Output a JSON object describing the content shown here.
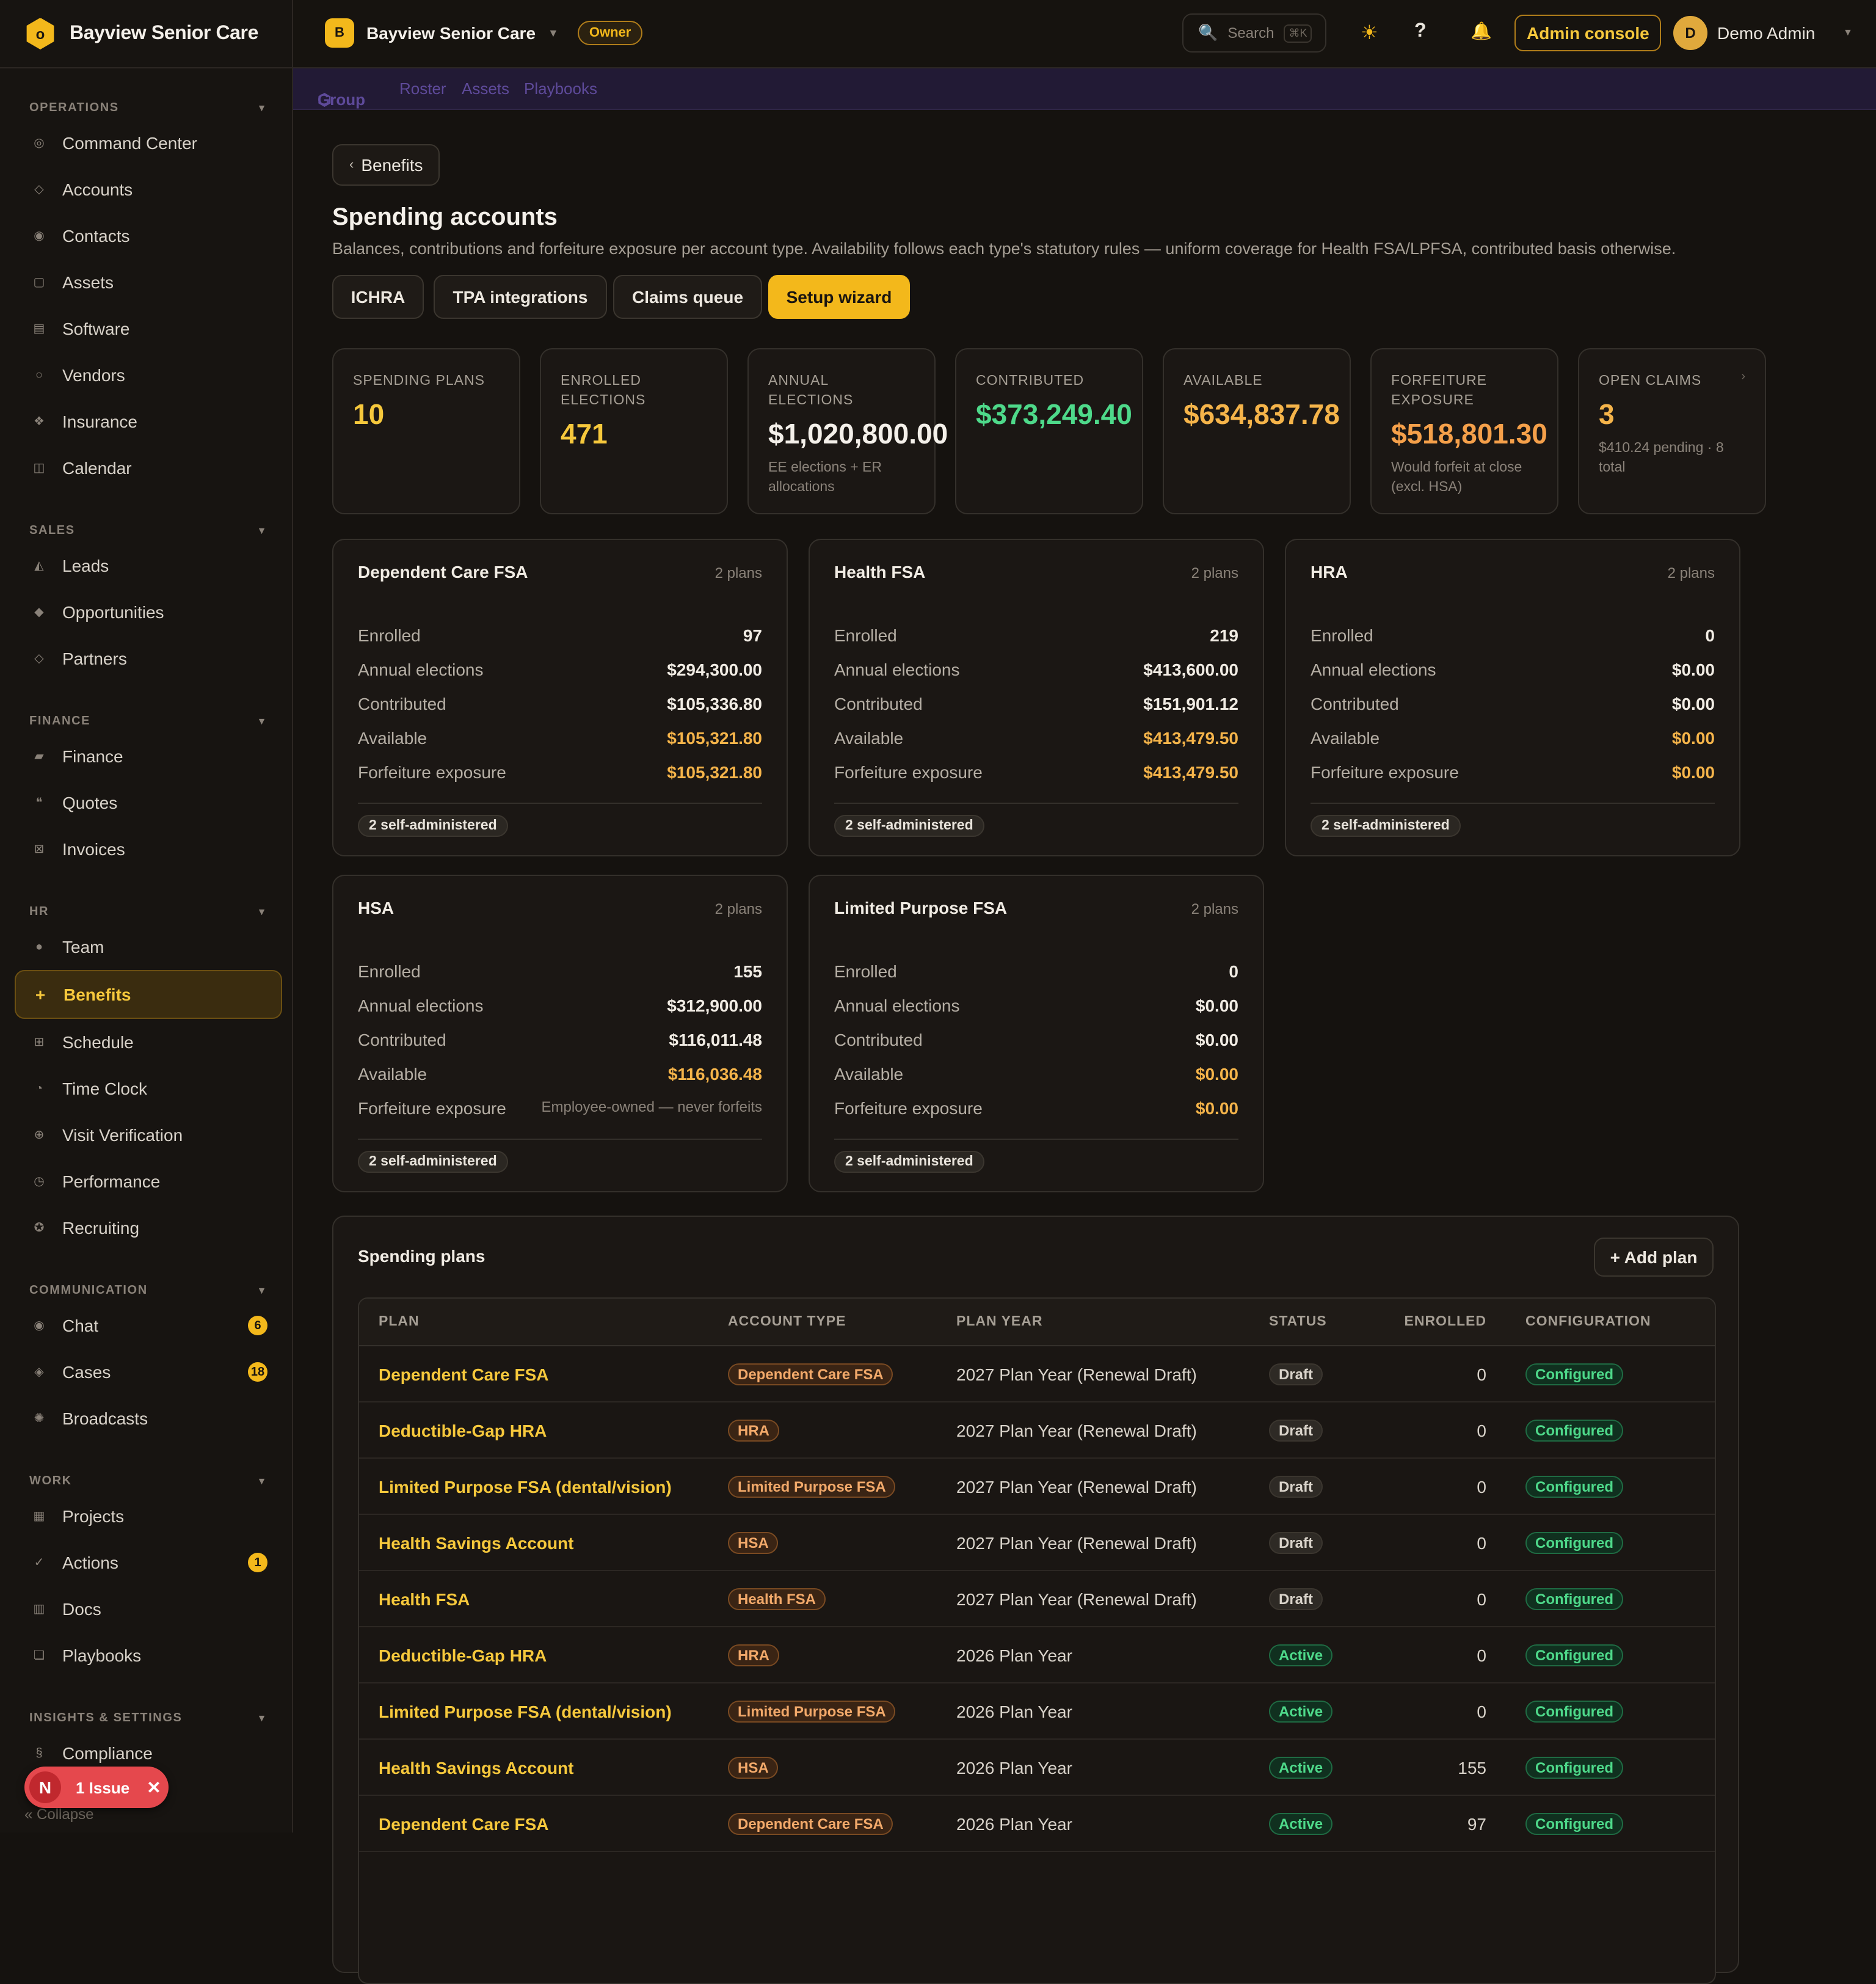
{
  "app": {
    "brand": "Bayview Senior Care",
    "logo_glyph": "o"
  },
  "topbar": {
    "org_initial": "B",
    "org_name": "Bayview Senior Care",
    "role_badge": "Owner",
    "search_placeholder": "Search",
    "search_shortcut": "⌘K",
    "admin_console": "Admin console",
    "user_initial": "D",
    "user_name": "Demo Admin"
  },
  "subnav": {
    "items": [
      "Group",
      "Roster",
      "Assets",
      "Playbooks"
    ],
    "current_marker": "⬡"
  },
  "sidebar": {
    "sections": [
      {
        "title": "OPERATIONS",
        "items": [
          "Command Center",
          "Accounts",
          "Contacts",
          "Assets",
          "Software",
          "Vendors",
          "Insurance",
          "Calendar"
        ]
      },
      {
        "title": "SALES",
        "items": [
          "Leads",
          "Opportunities",
          "Partners"
        ]
      },
      {
        "title": "FINANCE",
        "items": [
          "Finance",
          "Quotes",
          "Invoices"
        ]
      },
      {
        "title": "HR",
        "items": [
          "Team",
          "Benefits",
          "Schedule",
          "Time Clock",
          "Visit Verification",
          "Performance",
          "Recruiting"
        ]
      },
      {
        "title": "COMMUNICATION",
        "items": [
          "Chat",
          "Cases",
          "Broadcasts"
        ]
      },
      {
        "title": "WORK",
        "items": [
          "Projects",
          "Actions",
          "Docs",
          "Playbooks"
        ]
      },
      {
        "title": "INSIGHTS & SETTINGS",
        "items": [
          "Compliance"
        ]
      }
    ],
    "badges": {
      "chat": "6",
      "cases": "18",
      "actions": "1"
    },
    "active": "Benefits",
    "collapse_label": "Collapse",
    "issue_label": "1 Issue",
    "issue_avatar": "N"
  },
  "page": {
    "back_label": "Benefits",
    "title": "Spending accounts",
    "subtitle": "Balances, contributions and forfeiture exposure per account type. Availability follows each type's statutory rules — uniform coverage for Health FSA/LPFSA, contributed basis otherwise.",
    "buttons": [
      "ICHRA",
      "TPA integrations",
      "Claims queue",
      "Setup wizard"
    ]
  },
  "stats": [
    {
      "label": "Spending plans",
      "value": "10",
      "sub": "",
      "color": "#f6c83c"
    },
    {
      "label": "Enrolled elections",
      "value": "471",
      "sub": "",
      "color": "#f6c83c"
    },
    {
      "label": "Annual elections",
      "value": "$1,020,800.00",
      "sub": "EE elections + ER allocations",
      "color": "#f4f0ea"
    },
    {
      "label": "Contributed",
      "value": "$373,249.40",
      "sub": "",
      "color": "#4ed98a"
    },
    {
      "label": "Available",
      "value": "$634,837.78",
      "sub": "",
      "color": "#f5b44a"
    },
    {
      "label": "Forfeiture exposure",
      "value": "$518,801.30",
      "sub": "Would forfeit at close (excl. HSA)",
      "color": "#f5a04a"
    },
    {
      "label": "Open claims",
      "value": "3",
      "sub": "$410.24 pending · 8 total",
      "color": "#f5b44a"
    }
  ],
  "row_labels": [
    "Enrolled",
    "Annual elections",
    "Contributed",
    "Available",
    "Forfeiture exposure"
  ],
  "account_cards": [
    {
      "name": "Dependent Care FSA",
      "plans": "2 plans",
      "enrolled": "97",
      "elections": "$294,300.00",
      "contributed": "$105,336.80",
      "available": "$105,321.80",
      "forfeiture": "$105,321.80",
      "chip": "2 self-administered"
    },
    {
      "name": "Health FSA",
      "plans": "2 plans",
      "enrolled": "219",
      "elections": "$413,600.00",
      "contributed": "$151,901.12",
      "available": "$413,479.50",
      "forfeiture": "$413,479.50",
      "chip": "2 self-administered"
    },
    {
      "name": "HRA",
      "plans": "2 plans",
      "enrolled": "0",
      "elections": "$0.00",
      "contributed": "$0.00",
      "available": "$0.00",
      "forfeiture": "$0.00",
      "chip": "2 self-administered"
    },
    {
      "name": "HSA",
      "plans": "2 plans",
      "enrolled": "155",
      "elections": "$312,900.00",
      "contributed": "$116,011.48",
      "available": "$116,036.48",
      "forfeiture": "Employee-owned — never forfeits",
      "chip": "2 self-administered"
    },
    {
      "name": "Limited Purpose FSA",
      "plans": "2 plans",
      "enrolled": "0",
      "elections": "$0.00",
      "contributed": "$0.00",
      "available": "$0.00",
      "forfeiture": "$0.00",
      "chip": "2 self-administered"
    }
  ],
  "plans_table": {
    "title": "Spending plans",
    "add_label": "+ Add plan",
    "columns": [
      "PLAN",
      "ACCOUNT TYPE",
      "PLAN YEAR",
      "STATUS",
      "ENROLLED",
      "CONFIGURATION"
    ],
    "rows": [
      {
        "plan": "Dependent Care FSA",
        "type": "Dependent Care FSA",
        "year": "2027 Plan Year (Renewal Draft)",
        "status": "Draft",
        "enrolled": "0",
        "config": "Configured"
      },
      {
        "plan": "Deductible-Gap HRA",
        "type": "HRA",
        "year": "2027 Plan Year (Renewal Draft)",
        "status": "Draft",
        "enrolled": "0",
        "config": "Configured"
      },
      {
        "plan": "Limited Purpose FSA (dental/vision)",
        "type": "Limited Purpose FSA",
        "year": "2027 Plan Year (Renewal Draft)",
        "status": "Draft",
        "enrolled": "0",
        "config": "Configured"
      },
      {
        "plan": "Health Savings Account",
        "type": "HSA",
        "year": "2027 Plan Year (Renewal Draft)",
        "status": "Draft",
        "enrolled": "0",
        "config": "Configured"
      },
      {
        "plan": "Health FSA",
        "type": "Health FSA",
        "year": "2027 Plan Year (Renewal Draft)",
        "status": "Draft",
        "enrolled": "0",
        "config": "Configured"
      },
      {
        "plan": "Deductible-Gap HRA",
        "type": "HRA",
        "year": "2026 Plan Year",
        "status": "Active",
        "enrolled": "0",
        "config": "Configured"
      },
      {
        "plan": "Limited Purpose FSA (dental/vision)",
        "type": "Limited Purpose FSA",
        "year": "2026 Plan Year",
        "status": "Active",
        "enrolled": "0",
        "config": "Configured"
      },
      {
        "plan": "Health Savings Account",
        "type": "HSA",
        "year": "2026 Plan Year",
        "status": "Active",
        "enrolled": "155",
        "config": "Configured"
      },
      {
        "plan": "Dependent Care FSA",
        "type": "Dependent Care FSA",
        "year": "2026 Plan Year",
        "status": "Active",
        "enrolled": "97",
        "config": "Configured"
      }
    ]
  }
}
